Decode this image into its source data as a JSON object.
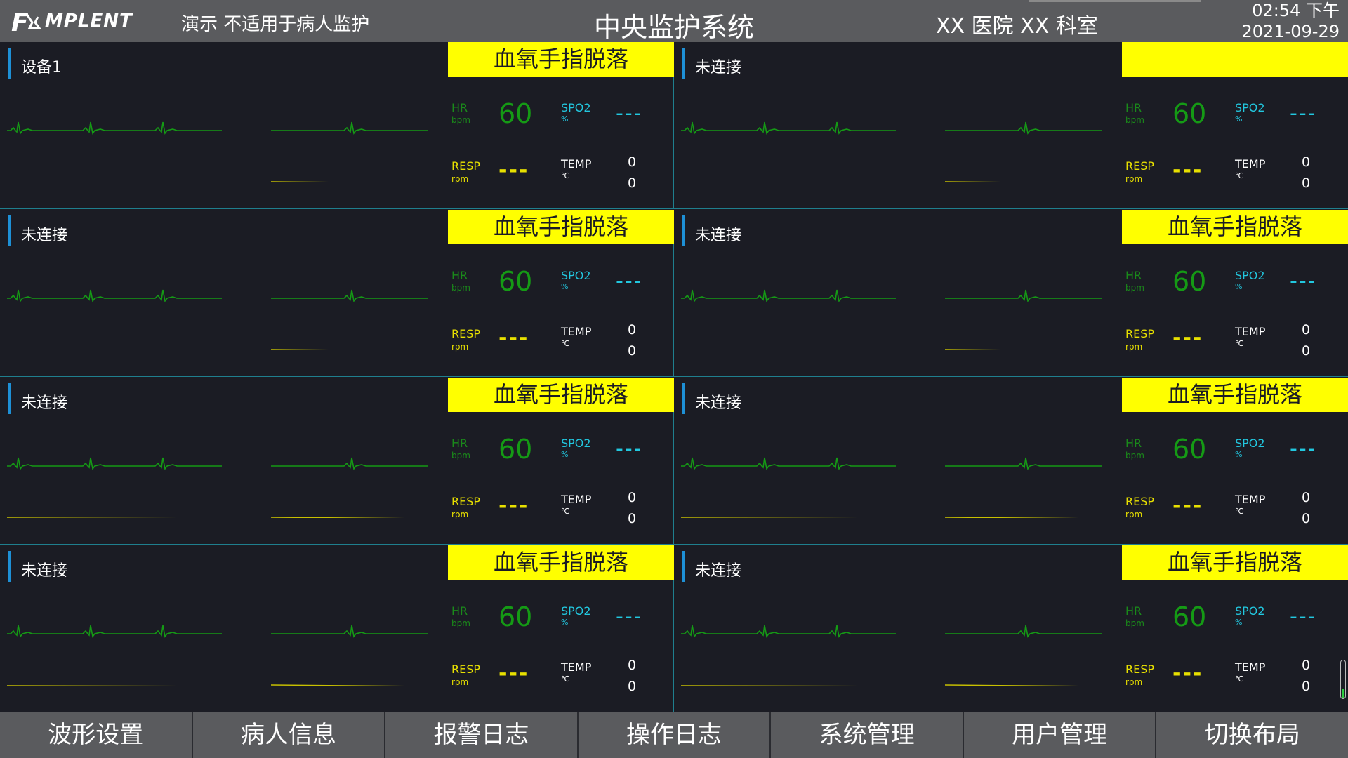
{
  "header": {
    "logo_text": "MPLENT",
    "logo_letter": "F",
    "demo_label": "演示  不适用于病人监护",
    "title": "中央监护系统",
    "hospital": "XX 医院 XX 科室",
    "time": "02:54  下午",
    "date": "2021-09-29"
  },
  "panels": [
    {
      "name": "设备1",
      "alarm": "血氧手指脱落",
      "hr_label": "HR",
      "hr_unit": "bpm",
      "hr": "60",
      "spo2_label": "SPO2",
      "spo2_unit": "%",
      "spo2": "---",
      "resp_label": "RESP",
      "resp_unit": "rpm",
      "resp": "---",
      "temp_label": "TEMP",
      "temp_unit": "℃",
      "temp1": "0",
      "temp2": "0"
    },
    {
      "name": "未连接",
      "alarm": "",
      "hr_label": "HR",
      "hr_unit": "bpm",
      "hr": "60",
      "spo2_label": "SPO2",
      "spo2_unit": "%",
      "spo2": "---",
      "resp_label": "RESP",
      "resp_unit": "rpm",
      "resp": "---",
      "temp_label": "TEMP",
      "temp_unit": "℃",
      "temp1": "0",
      "temp2": "0"
    },
    {
      "name": "未连接",
      "alarm": "血氧手指脱落",
      "hr_label": "HR",
      "hr_unit": "bpm",
      "hr": "60",
      "spo2_label": "SPO2",
      "spo2_unit": "%",
      "spo2": "---",
      "resp_label": "RESP",
      "resp_unit": "rpm",
      "resp": "---",
      "temp_label": "TEMP",
      "temp_unit": "℃",
      "temp1": "0",
      "temp2": "0"
    },
    {
      "name": "未连接",
      "alarm": "血氧手指脱落",
      "hr_label": "HR",
      "hr_unit": "bpm",
      "hr": "60",
      "spo2_label": "SPO2",
      "spo2_unit": "%",
      "spo2": "---",
      "resp_label": "RESP",
      "resp_unit": "rpm",
      "resp": "---",
      "temp_label": "TEMP",
      "temp_unit": "℃",
      "temp1": "0",
      "temp2": "0"
    },
    {
      "name": "未连接",
      "alarm": "血氧手指脱落",
      "hr_label": "HR",
      "hr_unit": "bpm",
      "hr": "60",
      "spo2_label": "SPO2",
      "spo2_unit": "%",
      "spo2": "---",
      "resp_label": "RESP",
      "resp_unit": "rpm",
      "resp": "---",
      "temp_label": "TEMP",
      "temp_unit": "℃",
      "temp1": "0",
      "temp2": "0"
    },
    {
      "name": "未连接",
      "alarm": "血氧手指脱落",
      "hr_label": "HR",
      "hr_unit": "bpm",
      "hr": "60",
      "spo2_label": "SPO2",
      "spo2_unit": "%",
      "spo2": "---",
      "resp_label": "RESP",
      "resp_unit": "rpm",
      "resp": "---",
      "temp_label": "TEMP",
      "temp_unit": "℃",
      "temp1": "0",
      "temp2": "0"
    },
    {
      "name": "未连接",
      "alarm": "血氧手指脱落",
      "hr_label": "HR",
      "hr_unit": "bpm",
      "hr": "60",
      "spo2_label": "SPO2",
      "spo2_unit": "%",
      "spo2": "---",
      "resp_label": "RESP",
      "resp_unit": "rpm",
      "resp": "---",
      "temp_label": "TEMP",
      "temp_unit": "℃",
      "temp1": "0",
      "temp2": "0"
    },
    {
      "name": "未连接",
      "alarm": "血氧手指脱落",
      "hr_label": "HR",
      "hr_unit": "bpm",
      "hr": "60",
      "spo2_label": "SPO2",
      "spo2_unit": "%",
      "spo2": "---",
      "resp_label": "RESP",
      "resp_unit": "rpm",
      "resp": "---",
      "temp_label": "TEMP",
      "temp_unit": "℃",
      "temp1": "0",
      "temp2": "0"
    }
  ],
  "footer": {
    "buttons": [
      "波形设置",
      "病人信息",
      "报警日志",
      "操作日志",
      "系统管理",
      "用户管理",
      "切换布局"
    ]
  },
  "colors": {
    "background": "#1b1c24",
    "header": "#5a5b5e",
    "alarm": "#ffff00",
    "ecg": "#159a15",
    "spo2": "#22c8e0",
    "resp": "#e8e000",
    "divider": "#1f7f8e"
  },
  "icons": {
    "logo": "lab-flask-logo-icon",
    "scroll": "scroll-indicator-icon"
  }
}
